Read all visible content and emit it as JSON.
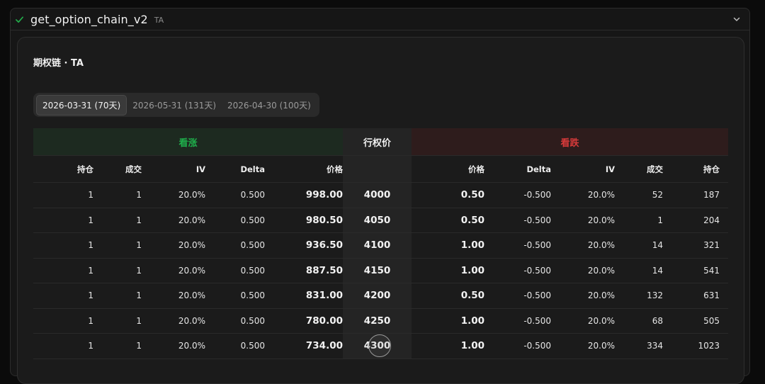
{
  "tool": {
    "name": "get_option_chain_v2",
    "badge": "TA"
  },
  "card": {
    "title": "期权链 · TA"
  },
  "tabs": [
    {
      "label": "2026-03-31 (70天)",
      "active": true
    },
    {
      "label": "2026-05-31 (131天)",
      "active": false
    },
    {
      "label": "2026-04-30 (100天)",
      "active": false
    }
  ],
  "groups": {
    "call": "看涨",
    "strike": "行权价",
    "put": "看跌"
  },
  "headers": {
    "call": [
      "持仓",
      "成交",
      "IV",
      "Delta",
      "价格"
    ],
    "strike": "",
    "put": [
      "价格",
      "Delta",
      "IV",
      "成交",
      "持仓"
    ]
  },
  "rows": [
    {
      "call": [
        "1",
        "1",
        "20.0%",
        "0.500",
        "998.00"
      ],
      "strike": "4000",
      "put": [
        "0.50",
        "-0.500",
        "20.0%",
        "52",
        "187"
      ]
    },
    {
      "call": [
        "1",
        "1",
        "20.0%",
        "0.500",
        "980.50"
      ],
      "strike": "4050",
      "put": [
        "0.50",
        "-0.500",
        "20.0%",
        "1",
        "204"
      ]
    },
    {
      "call": [
        "1",
        "1",
        "20.0%",
        "0.500",
        "936.50"
      ],
      "strike": "4100",
      "put": [
        "1.00",
        "-0.500",
        "20.0%",
        "14",
        "321"
      ]
    },
    {
      "call": [
        "1",
        "1",
        "20.0%",
        "0.500",
        "887.50"
      ],
      "strike": "4150",
      "put": [
        "1.00",
        "-0.500",
        "20.0%",
        "14",
        "541"
      ]
    },
    {
      "call": [
        "1",
        "1",
        "20.0%",
        "0.500",
        "831.00"
      ],
      "strike": "4200",
      "put": [
        "0.50",
        "-0.500",
        "20.0%",
        "132",
        "631"
      ]
    },
    {
      "call": [
        "1",
        "1",
        "20.0%",
        "0.500",
        "780.00"
      ],
      "strike": "4250",
      "put": [
        "1.00",
        "-0.500",
        "20.0%",
        "68",
        "505"
      ]
    },
    {
      "call": [
        "1",
        "1",
        "20.0%",
        "0.500",
        "734.00"
      ],
      "strike": "4300",
      "put": [
        "1.00",
        "-0.500",
        "20.0%",
        "334",
        "1023"
      ]
    }
  ]
}
